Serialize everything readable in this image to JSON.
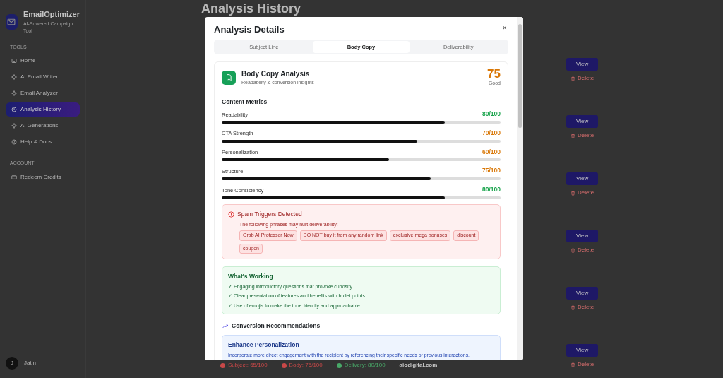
{
  "sidebar": {
    "brand": "EmailOptimizer",
    "tagline": "AI-Powered Campaign Tool",
    "sections": [
      {
        "heading": "TOOLS",
        "items": [
          {
            "label": "Home",
            "selected": false
          },
          {
            "label": "AI Email Writer",
            "selected": false
          },
          {
            "label": "Email Analyzer",
            "selected": false
          },
          {
            "label": "Analysis History",
            "selected": true
          },
          {
            "label": "AI Generations",
            "selected": false
          },
          {
            "label": "Help & Docs",
            "selected": false
          }
        ]
      },
      {
        "heading": "ACCOUNT",
        "items": [
          {
            "label": "Redeem Credits",
            "selected": false
          }
        ]
      }
    ],
    "user": {
      "initial": "J",
      "name": "Jatin"
    }
  },
  "page": {
    "title": "Analysis History",
    "rows": [
      {
        "view": "View",
        "delete": "Delete"
      },
      {
        "view": "View",
        "delete": "Delete"
      },
      {
        "view": "View",
        "delete": "Delete"
      },
      {
        "view": "View",
        "delete": "Delete"
      },
      {
        "view": "View",
        "delete": "Delete"
      },
      {
        "view": "View",
        "delete": "Delete"
      }
    ],
    "footer": [
      {
        "label": "Subject: 65/100",
        "color": "#c84848"
      },
      {
        "label": "Body: 75/100",
        "color": "#c84848"
      },
      {
        "label": "Delivery: 80/100",
        "color": "#48a868"
      }
    ],
    "footer_site": "aiodigital.com"
  },
  "modal": {
    "title": "Analysis Details",
    "close": "×",
    "tabs": [
      {
        "label": "Subject Line",
        "selected": false
      },
      {
        "label": "Body Copy",
        "selected": true
      },
      {
        "label": "Deliverability",
        "selected": false
      }
    ],
    "header": {
      "title": "Body Copy Analysis",
      "subtitle": "Readability & conversion insights",
      "score": "75",
      "rating": "Good"
    },
    "metrics_title": "Content Metrics",
    "metrics": [
      {
        "name": "Readability",
        "value": "80/100",
        "color": "#16a34a",
        "level": 0.8
      },
      {
        "name": "CTA Strength",
        "value": "70/100",
        "color": "#d97706",
        "level": 0.7
      },
      {
        "name": "Personalization",
        "value": "60/100",
        "color": "#d97706",
        "level": 0.6
      },
      {
        "name": "Structure",
        "value": "75/100",
        "color": "#d97706",
        "level": 0.75
      },
      {
        "name": "Tone Consistency",
        "value": "80/100",
        "color": "#16a34a",
        "level": 0.8
      }
    ],
    "spam": {
      "title": "Spam Triggers Detected",
      "text": "The following phrases may hurt deliverability:",
      "phrases": [
        "Grab AI Professor Now",
        "DO NOT buy it from any random link",
        "exclusive mega bonuses",
        "discount",
        "coupon"
      ]
    },
    "working": {
      "title": "What's Working",
      "items": [
        "✓ Engaging introductory questions that provoke curiosity.",
        "✓ Clear presentation of features and benefits with bullet points.",
        "✓ Use of emojis to make the tone friendly and approachable."
      ]
    },
    "recommendations": {
      "title": "Conversion Recommendations",
      "items": [
        {
          "title": "Enhance Personalization",
          "text": "Incorporate more direct engagement with the recipient by referencing their specific needs or previous interactions."
        }
      ]
    }
  }
}
